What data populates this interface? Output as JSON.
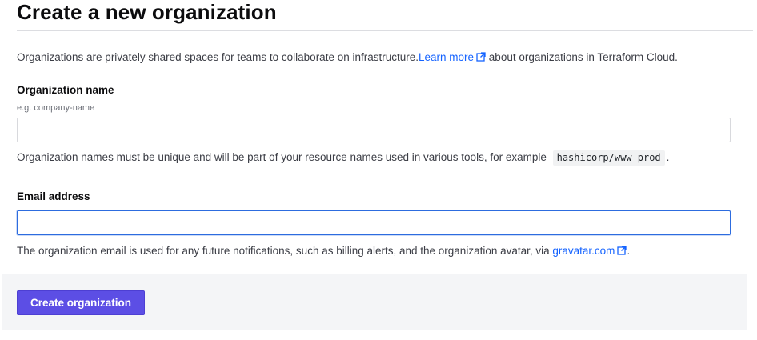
{
  "page": {
    "title": "Create a new organization"
  },
  "intro": {
    "text_before": "Organizations are privately shared spaces for teams to collaborate on infrastructure.",
    "link_label": "Learn more",
    "text_after": " about organizations in Terraform Cloud."
  },
  "org_name": {
    "label": "Organization name",
    "hint": "e.g. company-name",
    "value": "",
    "helper_text": "Organization names must be unique and will be part of your resource names used in various tools, for example ",
    "example_code": "hashicorp/www-prod",
    "helper_suffix": "."
  },
  "email": {
    "label": "Email address",
    "value": "",
    "helper_text": "The organization email is used for any future notifications, such as billing alerts, and the organization avatar, via ",
    "link_label": "gravatar.com",
    "helper_suffix": "."
  },
  "actions": {
    "create_label": "Create organization"
  },
  "icons": {
    "external_link": "external-link-icon"
  },
  "colors": {
    "primary_button": "#5c4ee5",
    "link": "#1563ff",
    "focus_border": "#2d6cdf"
  }
}
